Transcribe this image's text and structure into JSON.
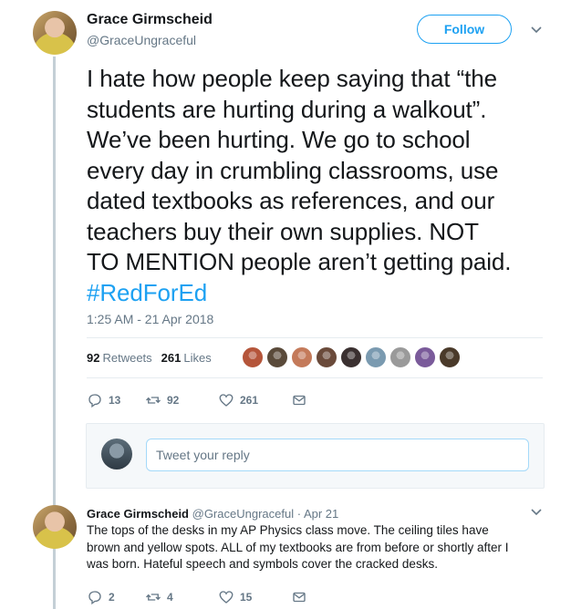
{
  "tweet": {
    "author_name": "Grace Girmscheid",
    "author_handle": "@GraceUngraceful",
    "follow_label": "Follow",
    "text_lines": [
      "I hate how people keep saying that “the",
      "students are hurting during a walkout”.",
      "We’ve been hurting. We go to school",
      "every day in crumbling classrooms, use",
      "dated textbooks as references, and our",
      "teachers buy their own supplies. NOT",
      "TO MENTION people aren’t getting paid."
    ],
    "hashtag": "#RedForEd",
    "timestamp": "1:25 AM - 21 Apr 2018",
    "retweets_count": "92",
    "retweets_label": "Retweets",
    "likes_count": "261",
    "likes_label": "Likes",
    "liker_colors": [
      "#b5553a",
      "#5a4a3a",
      "#c47a5a",
      "#6a4a3a",
      "#3a3030",
      "#7a9ab0",
      "#9a9a9a",
      "#7a5a9a",
      "#4a3a2a"
    ],
    "actions": {
      "replies": "13",
      "retweets": "92",
      "likes": "261"
    }
  },
  "reply_composer": {
    "placeholder": "Tweet your reply"
  },
  "reply": {
    "author_name": "Grace Girmscheid",
    "author_handle": "@GraceUngraceful",
    "separator": "·",
    "date": "Apr 21",
    "text_lines": [
      "The tops of the desks in my AP Physics class move. The ceiling tiles have",
      "brown and yellow spots. ALL of my textbooks are from before or shortly after I",
      "was born. Hateful speech and symbols cover the cracked desks."
    ],
    "actions": {
      "replies": "2",
      "retweets": "4",
      "likes": "15"
    }
  },
  "colors": {
    "accent": "#1da1f2",
    "muted": "#657786",
    "text": "#14171a",
    "border": "#e6ecf0"
  }
}
